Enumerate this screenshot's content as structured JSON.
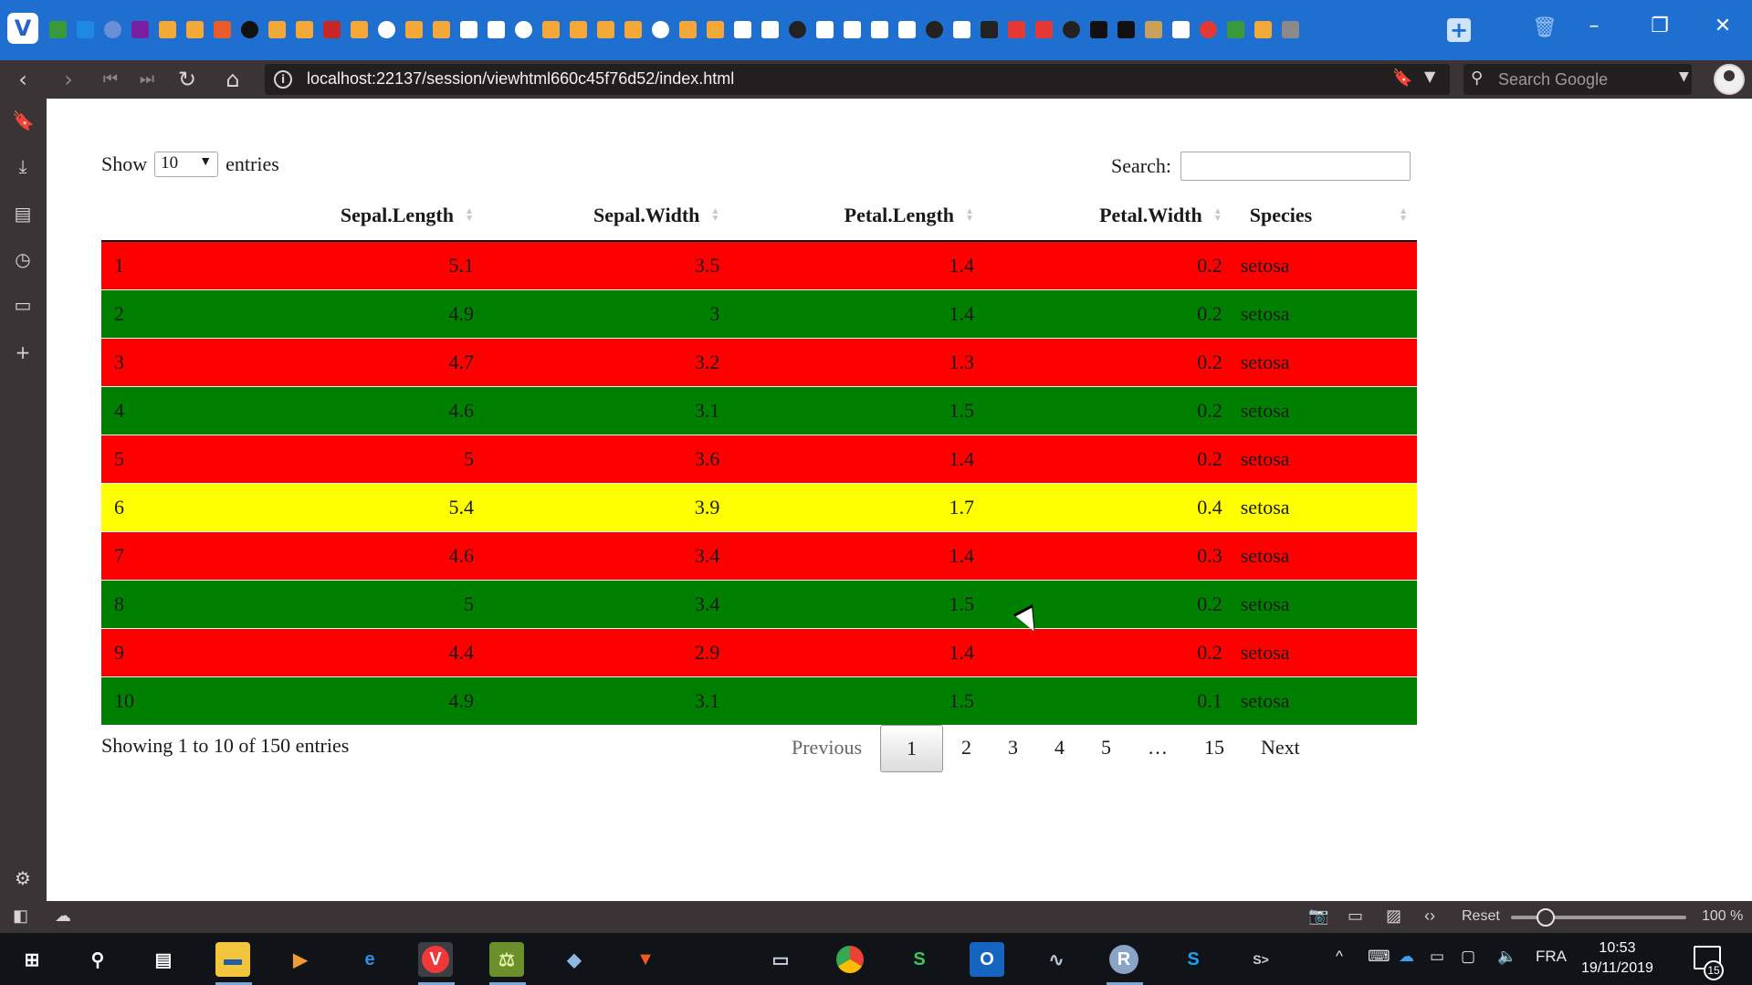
{
  "browser": {
    "url": "localhost:22137/session/viewhtml660c45f76d52/index.html",
    "search_placeholder": "Search Google",
    "zoom_reset_label": "Reset",
    "zoom_level": "100 %",
    "tab_favicon_colors": [
      "#3a9a3a",
      "#1e88e5",
      "#6a8fd6",
      "#7b1fa2",
      "#f4a83a",
      "#f4a83a",
      "#e85d2a",
      "#111111",
      "#f4a83a",
      "#f4a83a",
      "#c62828",
      "#f4a83a",
      "#ffffff",
      "#f4a83a",
      "#f4a83a",
      "#ffffff",
      "#ffffff",
      "#ffffff",
      "#f4a83a",
      "#f4a83a",
      "#f4a83a",
      "#f4a83a",
      "#ffffff",
      "#f4a83a",
      "#f4a83a",
      "#ffffff",
      "#ffffff",
      "#222222",
      "#ffffff",
      "#ffffff",
      "#ffffff",
      "#ffffff",
      "#222222",
      "#ffffff",
      "#222222",
      "#e53935",
      "#e53935",
      "#222222",
      "#111111",
      "#111111",
      "#c9a15a",
      "#ffffff",
      "#e53935",
      "#3a9a3a",
      "#f4a83a",
      "#8a8a8a"
    ]
  },
  "datatable": {
    "length_label_before": "Show",
    "length_value": "10",
    "length_label_after": "entries",
    "search_label": "Search:",
    "search_value": "",
    "columns": [
      "",
      "Sepal.Length",
      "Sepal.Width",
      "Petal.Length",
      "Petal.Width",
      "Species"
    ],
    "rows": [
      {
        "idx": "1",
        "sepal_length": "5.1",
        "sepal_width": "3.5",
        "petal_length": "1.4",
        "petal_width": "0.2",
        "species": "setosa",
        "row_color": "#ff0000"
      },
      {
        "idx": "2",
        "sepal_length": "4.9",
        "sepal_width": "3",
        "petal_length": "1.4",
        "petal_width": "0.2",
        "species": "setosa",
        "row_color": "#008000"
      },
      {
        "idx": "3",
        "sepal_length": "4.7",
        "sepal_width": "3.2",
        "petal_length": "1.3",
        "petal_width": "0.2",
        "species": "setosa",
        "row_color": "#ff0000"
      },
      {
        "idx": "4",
        "sepal_length": "4.6",
        "sepal_width": "3.1",
        "petal_length": "1.5",
        "petal_width": "0.2",
        "species": "setosa",
        "row_color": "#008000"
      },
      {
        "idx": "5",
        "sepal_length": "5",
        "sepal_width": "3.6",
        "petal_length": "1.4",
        "petal_width": "0.2",
        "species": "setosa",
        "row_color": "#ff0000"
      },
      {
        "idx": "6",
        "sepal_length": "5.4",
        "sepal_width": "3.9",
        "petal_length": "1.7",
        "petal_width": "0.4",
        "species": "setosa",
        "row_color": "#ffff00"
      },
      {
        "idx": "7",
        "sepal_length": "4.6",
        "sepal_width": "3.4",
        "petal_length": "1.4",
        "petal_width": "0.3",
        "species": "setosa",
        "row_color": "#ff0000"
      },
      {
        "idx": "8",
        "sepal_length": "5",
        "sepal_width": "3.4",
        "petal_length": "1.5",
        "petal_width": "0.2",
        "species": "setosa",
        "row_color": "#008000"
      },
      {
        "idx": "9",
        "sepal_length": "4.4",
        "sepal_width": "2.9",
        "petal_length": "1.4",
        "petal_width": "0.2",
        "species": "setosa",
        "row_color": "#ff0000"
      },
      {
        "idx": "10",
        "sepal_length": "4.9",
        "sepal_width": "3.1",
        "petal_length": "1.5",
        "petal_width": "0.1",
        "species": "setosa",
        "row_color": "#008000"
      }
    ],
    "info": "Showing 1 to 10 of 150 entries",
    "pagination": {
      "previous": "Previous",
      "pages": [
        "1",
        "2",
        "3",
        "4",
        "5",
        "…",
        "15"
      ],
      "current": "1",
      "next": "Next"
    }
  },
  "taskbar": {
    "language": "FRA",
    "time": "10:53",
    "date": "19/11/2019",
    "notification_count": "15"
  }
}
